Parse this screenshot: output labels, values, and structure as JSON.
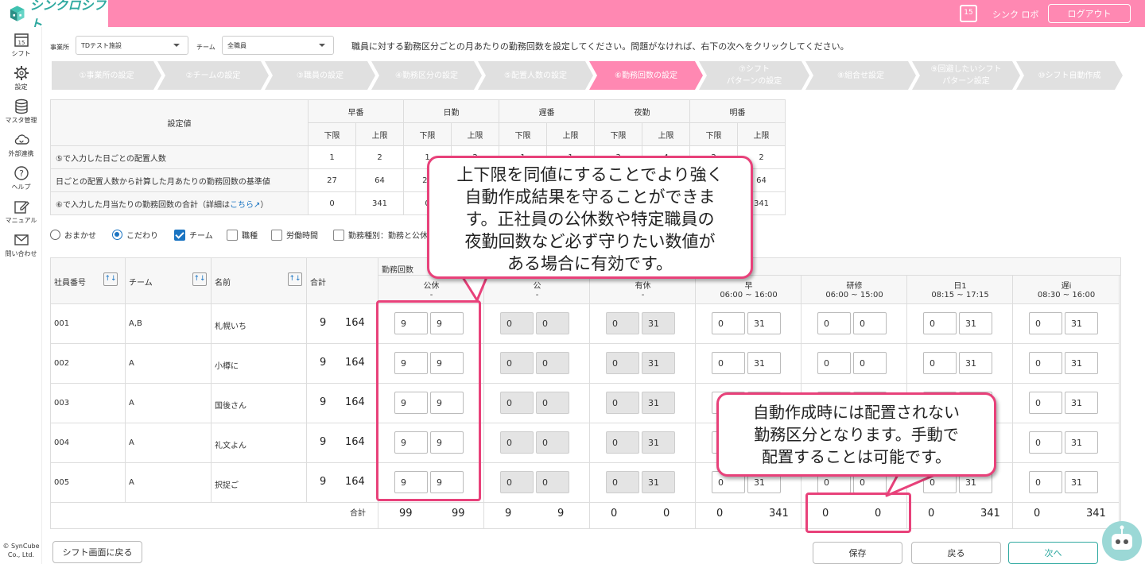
{
  "header": {
    "logo": "シンクロシフト",
    "calendar_day": "15",
    "user": "シンク ロボ",
    "logout": "ログアウト"
  },
  "sidebar": {
    "items": [
      {
        "label": "シフト",
        "icon": "calendar-icon"
      },
      {
        "label": "設定",
        "icon": "gear-icon"
      },
      {
        "label": "マスタ管理",
        "icon": "database-icon"
      },
      {
        "label": "外部連携",
        "icon": "cloud-sync-icon"
      },
      {
        "label": "ヘルプ",
        "icon": "help-icon"
      },
      {
        "label": "マニュアル",
        "icon": "edit-icon"
      },
      {
        "label": "問い合わせ",
        "icon": "mail-icon"
      }
    ],
    "copyright": [
      "© SynCube",
      "Co., Ltd."
    ]
  },
  "filters_top": {
    "office_label": "事業所",
    "office_value": "TDテスト施設",
    "team_label": "チーム",
    "team_value": "全職員"
  },
  "instruction": "職員に対する勤務区分ごとの月あたりの勤務回数を設定してください。問題がなければ、右下の次へをクリックしてください。",
  "steps": [
    "①事業所の設定",
    "②チームの設定",
    "③職員の設定",
    "④勤務区分の設定",
    "⑤配置人数の設定",
    "⑥勤務回数の設定",
    "⑦シフト\nパターンの設定",
    "⑧組合せ設定",
    "⑨回避したいシフト\nパターン設定",
    "⑩シフト自動作成"
  ],
  "active_step": 5,
  "summary": {
    "corner": "設定値",
    "groups": [
      "早番",
      "日勤",
      "遅番",
      "夜勤",
      "明番"
    ],
    "sub": [
      "下限",
      "上限"
    ],
    "rows": [
      {
        "label": "⑤で入力した日ごとの配置人数",
        "values": [
          "1",
          "2",
          "1",
          "2",
          "1",
          "1",
          "3",
          "4",
          "2",
          "2"
        ]
      },
      {
        "label": "日ごとの配置人数から計算した月あたりの勤務回数の基準値",
        "values": [
          "27",
          "64",
          "27",
          "64",
          "27",
          "31",
          "81",
          "124",
          "54",
          "64"
        ]
      },
      {
        "label": "⑥で入力した月当たりの勤務回数の合計（詳細は",
        "link": "こちら",
        "suffix": "）",
        "values": [
          "0",
          "341",
          "0",
          "341",
          "0",
          "341",
          "0",
          "341",
          "0",
          "341"
        ]
      }
    ]
  },
  "filters": {
    "radio": [
      {
        "label": "おまかせ",
        "checked": false
      },
      {
        "label": "こだわり",
        "checked": true
      }
    ],
    "checks": [
      {
        "label": "チーム",
        "checked": true
      },
      {
        "label": "職種",
        "checked": false
      },
      {
        "label": "労働時間",
        "checked": false
      },
      {
        "label": "勤務種別：勤務と公休",
        "checked": false
      }
    ]
  },
  "grid": {
    "col_headers": {
      "emp": "社員番号",
      "team": "チーム",
      "name": "名前",
      "total": "合計",
      "group": "勤務回数"
    },
    "shift_cols": [
      {
        "name": "公休",
        "time": "-",
        "disabled": false
      },
      {
        "name": "公",
        "time": "-",
        "disabled": true
      },
      {
        "name": "有休",
        "time": "-",
        "disabled": true
      },
      {
        "name": "早",
        "time": "06:00 ~ 16:00",
        "disabled": false
      },
      {
        "name": "研修",
        "time": "06:00 ~ 15:00",
        "disabled": false
      },
      {
        "name": "日1",
        "time": "08:15 ~ 17:15",
        "disabled": false
      },
      {
        "name": "遅i",
        "time": "08:30 ~ 16:00",
        "disabled": false
      }
    ],
    "rows": [
      {
        "id": "001",
        "team": "A,B",
        "name": "札幌いち",
        "tmin": "9",
        "tmax": "164",
        "cells": [
          [
            "9",
            "9"
          ],
          [
            "0",
            "0"
          ],
          [
            "0",
            "31"
          ],
          [
            "0",
            "31"
          ],
          [
            "0",
            "0"
          ],
          [
            "0",
            "31"
          ],
          [
            "0",
            "31"
          ]
        ]
      },
      {
        "id": "002",
        "team": "A",
        "name": "小樽に",
        "tmin": "9",
        "tmax": "164",
        "cells": [
          [
            "9",
            "9"
          ],
          [
            "0",
            "0"
          ],
          [
            "0",
            "31"
          ],
          [
            "0",
            "31"
          ],
          [
            "0",
            "0"
          ],
          [
            "0",
            "31"
          ],
          [
            "0",
            "31"
          ]
        ]
      },
      {
        "id": "003",
        "team": "A",
        "name": "国後さん",
        "tmin": "9",
        "tmax": "164",
        "cells": [
          [
            "9",
            "9"
          ],
          [
            "0",
            "0"
          ],
          [
            "0",
            "31"
          ],
          [
            "0",
            "31"
          ],
          [
            "0",
            "0"
          ],
          [
            "0",
            "31"
          ],
          [
            "0",
            "31"
          ]
        ]
      },
      {
        "id": "004",
        "team": "A",
        "name": "礼文よん",
        "tmin": "9",
        "tmax": "164",
        "cells": [
          [
            "9",
            "9"
          ],
          [
            "0",
            "0"
          ],
          [
            "0",
            "31"
          ],
          [
            "0",
            "31"
          ],
          [
            "0",
            "0"
          ],
          [
            "0",
            "31"
          ],
          [
            "0",
            "31"
          ]
        ]
      },
      {
        "id": "005",
        "team": "A",
        "name": "択捉ご",
        "tmin": "9",
        "tmax": "164",
        "cells": [
          [
            "9",
            "9"
          ],
          [
            "0",
            "0"
          ],
          [
            "0",
            "31"
          ],
          [
            "0",
            "31"
          ],
          [
            "0",
            "0"
          ],
          [
            "0",
            "31"
          ],
          [
            "0",
            "31"
          ]
        ]
      }
    ],
    "footer_label": "合計",
    "footer": [
      [
        "99",
        "99"
      ],
      [
        "9",
        "9"
      ],
      [
        "0",
        "0"
      ],
      [
        "0",
        "341"
      ],
      [
        "0",
        "0"
      ],
      [
        "0",
        "341"
      ],
      [
        "0",
        "341"
      ]
    ]
  },
  "buttons": {
    "back_to_shift": "シフト画面に戻る",
    "save": "保存",
    "back": "戻る",
    "next": "次へ"
  },
  "callouts": {
    "c1": [
      "上下限を同値にすることでより強く",
      "自動作成結果を守ることができま",
      "す。正社員の公休数や特定職員の",
      "夜勤回数など必ず守りたい数値が",
      "ある場合に有効です。"
    ],
    "c2": [
      "自動作成時には配置されない",
      "勤務区分となります。手動で",
      "配置することは可能です。"
    ]
  }
}
